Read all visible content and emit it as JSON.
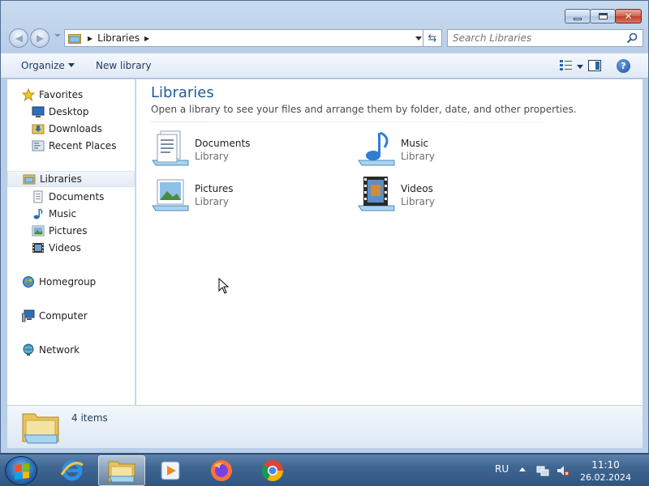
{
  "window": {
    "minimize": "minimize",
    "maximize": "maximize",
    "close": "close"
  },
  "addressbar": {
    "crumb": "Libraries",
    "search_placeholder": "Search Libraries"
  },
  "toolbar": {
    "organize_label": "Organize",
    "new_library_label": "New library"
  },
  "navpane": {
    "favorites": "Favorites",
    "favorites_items": [
      "Desktop",
      "Downloads",
      "Recent Places"
    ],
    "libraries": "Libraries",
    "libraries_items": [
      "Documents",
      "Music",
      "Pictures",
      "Videos"
    ],
    "homegroup": "Homegroup",
    "computer": "Computer",
    "network": "Network"
  },
  "content": {
    "title": "Libraries",
    "subtitle": "Open a library to see your files and arrange them by folder, date, and other properties.",
    "items": [
      {
        "name": "Documents",
        "type": "Library",
        "icon": "documents-library-icon"
      },
      {
        "name": "Music",
        "type": "Library",
        "icon": "music-library-icon"
      },
      {
        "name": "Pictures",
        "type": "Library",
        "icon": "pictures-library-icon"
      },
      {
        "name": "Videos",
        "type": "Library",
        "icon": "videos-library-icon"
      }
    ]
  },
  "details": {
    "count": "4 items"
  },
  "taskbar": {
    "apps": [
      "internet-explorer-icon",
      "windows-explorer-icon",
      "media-player-icon",
      "firefox-icon",
      "chrome-icon"
    ],
    "language": "RU",
    "time": "11:10",
    "date": "26.02.2024"
  },
  "colors": {
    "title_blue": "#1e5c96",
    "window_frame": "#b9cfe9",
    "taskbar": "#3f6691",
    "close_red": "#c2412a"
  }
}
